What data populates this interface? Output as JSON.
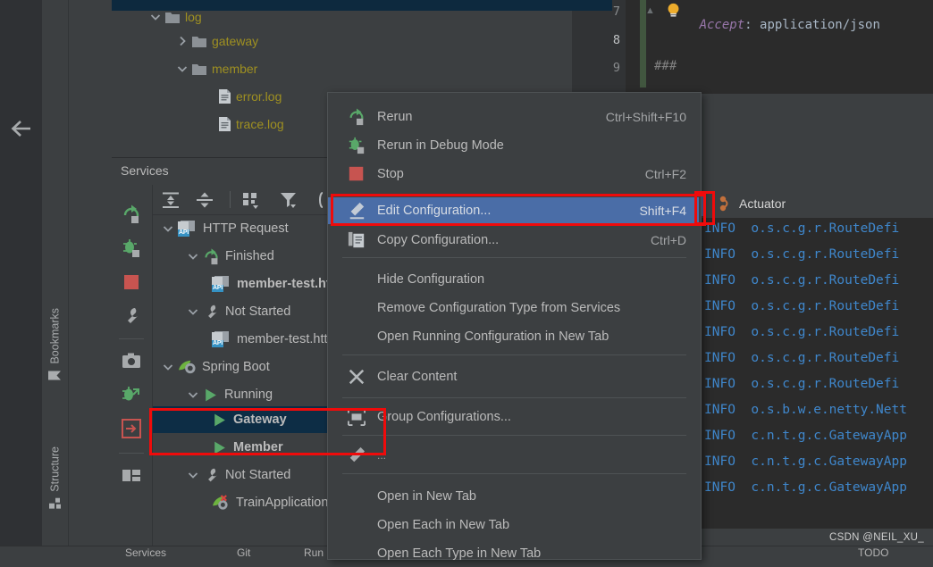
{
  "window": {
    "watermark": "CSDN @NEIL_XU_"
  },
  "left_rail": {
    "back_icon": "back-arrow-icon",
    "labels": [
      {
        "label": "Bookmarks",
        "icon": "bookmark-icon"
      },
      {
        "label": "Structure",
        "icon": "structure-icon"
      }
    ]
  },
  "editor": {
    "lines": [
      {
        "number": "7",
        "text": "Accept: application/json",
        "kind": "header"
      },
      {
        "number": "8",
        "text": "",
        "kind": "blank"
      },
      {
        "number": "9",
        "text": "###",
        "kind": "comment"
      }
    ],
    "header_name": "Accept",
    "header_value": "application/json",
    "comment_text": "###",
    "intention_icon": "lightbulb-icon",
    "fold_icon": "fold-marker-icon"
  },
  "project_tree": {
    "selected_file": "member-test.http",
    "nodes": [
      {
        "label": "log",
        "indent": 42,
        "chevron": "down",
        "icon": "folder-icon"
      },
      {
        "label": "gateway",
        "indent": 72,
        "chevron": "right",
        "icon": "folder-icon"
      },
      {
        "label": "member",
        "indent": 72,
        "chevron": "down",
        "icon": "folder-icon"
      },
      {
        "label": "error.log",
        "indent": 120,
        "chevron": "none",
        "icon": "log-file-icon"
      },
      {
        "label": "trace.log",
        "indent": 120,
        "chevron": "none",
        "icon": "log-file-icon"
      }
    ]
  },
  "services": {
    "title": "Services",
    "rail_buttons": [
      {
        "name": "rerun-icon"
      },
      {
        "name": "rerun-debug-icon"
      },
      {
        "name": "stop-icon"
      },
      {
        "name": "settings-wrench-icon"
      },
      {
        "name": "screenshot-camera-icon"
      },
      {
        "name": "debug-attach-icon"
      },
      {
        "name": "import-icon"
      },
      {
        "name": "layout-icon"
      }
    ],
    "toolbar_buttons": [
      {
        "name": "expand-all-icon"
      },
      {
        "name": "collapse-all-icon"
      },
      {
        "name": "group-by-icon"
      },
      {
        "name": "filter-icon"
      },
      {
        "name": "soft-wrap-icon"
      }
    ],
    "tree": [
      {
        "label": "HTTP Request",
        "indent": 10,
        "chevron": "down",
        "icon": "api-badge-icon",
        "bold": false
      },
      {
        "label": "Finished",
        "indent": 38,
        "chevron": "down",
        "icon": "rerun-icon",
        "bold": false
      },
      {
        "label": "member-test.http",
        "indent": 66,
        "chevron": "none",
        "icon": "api-badge-icon",
        "bold": true
      },
      {
        "label": "Not Started",
        "indent": 38,
        "chevron": "down",
        "icon": "settings-wrench-icon",
        "bold": false
      },
      {
        "label": "member-test.http",
        "indent": 66,
        "chevron": "none",
        "icon": "api-badge-icon",
        "bold": false
      },
      {
        "label": "Spring Boot",
        "indent": 10,
        "chevron": "down",
        "icon": "spring-boot-icon",
        "bold": false
      },
      {
        "label": "Running",
        "indent": 38,
        "chevron": "down",
        "icon": "run-triangle-icon",
        "bold": false
      },
      {
        "label": "Gateway",
        "indent": 66,
        "chevron": "none",
        "icon": "run-triangle-icon",
        "bold": true,
        "selected": true
      },
      {
        "label": "Member",
        "indent": 66,
        "chevron": "none",
        "icon": "run-triangle-icon",
        "bold": true
      },
      {
        "label": "Not Started",
        "indent": 38,
        "chevron": "down",
        "icon": "settings-wrench-icon",
        "bold": false
      },
      {
        "label": "TrainApplication",
        "indent": 66,
        "chevron": "none",
        "icon": "spring-boot-error-icon",
        "bold": false
      }
    ]
  },
  "context_menu": {
    "items": [
      {
        "label": "Rerun",
        "shortcut": "Ctrl+Shift+F10",
        "icon": "rerun-icon",
        "selected": false
      },
      {
        "label": "Rerun in Debug Mode",
        "shortcut": "",
        "icon": "rerun-debug-icon",
        "selected": false
      },
      {
        "label": "Stop",
        "shortcut": "Ctrl+F2",
        "icon": "stop-icon",
        "selected": false
      },
      {
        "label": "Edit Configuration...",
        "shortcut": "Shift+F4",
        "icon": "edit-pencil-icon",
        "selected": true
      },
      {
        "label": "Copy Configuration...",
        "shortcut": "Ctrl+D",
        "icon": "copy-icon",
        "selected": false
      },
      {
        "label": "Hide Configuration",
        "shortcut": "",
        "icon": "",
        "selected": false
      },
      {
        "label": "Remove Configuration Type from Services",
        "shortcut": "",
        "icon": "",
        "selected": false
      },
      {
        "label": "Open Running Configuration in New Tab",
        "shortcut": "",
        "icon": "",
        "selected": false
      },
      {
        "label": "Clear Content",
        "shortcut": "",
        "icon": "clear-x-icon",
        "selected": false
      },
      {
        "label": "Group Configurations...",
        "shortcut": "",
        "icon": "group-configurations-icon",
        "selected": false
      },
      {
        "label": "...",
        "shortcut": "",
        "icon": "edit-pencil-icon",
        "selected": false
      },
      {
        "label": "Open in New Tab",
        "shortcut": "",
        "icon": "",
        "selected": false
      },
      {
        "label": "Open Each in New Tab",
        "shortcut": "",
        "icon": "",
        "selected": false
      },
      {
        "label": "Open Each Type in New Tab",
        "shortcut": "",
        "icon": "",
        "selected": false
      }
    ]
  },
  "console": {
    "tab_label": "Actuator",
    "tab_icon": "actuator-icon",
    "log_lines": [
      {
        "level": "INFO",
        "logger": "o.s.c.g.r.RouteDefi"
      },
      {
        "level": "INFO",
        "logger": "o.s.c.g.r.RouteDefi"
      },
      {
        "level": "INFO",
        "logger": "o.s.c.g.r.RouteDefi"
      },
      {
        "level": "INFO",
        "logger": "o.s.c.g.r.RouteDefi"
      },
      {
        "level": "INFO",
        "logger": "o.s.c.g.r.RouteDefi"
      },
      {
        "level": "INFO",
        "logger": "o.s.c.g.r.RouteDefi"
      },
      {
        "level": "INFO",
        "logger": "o.s.c.g.r.RouteDefi"
      },
      {
        "level": "INFO",
        "logger": "o.s.b.w.e.netty.Nett"
      },
      {
        "level": "INFO",
        "logger": "c.n.t.g.c.GatewayApp"
      },
      {
        "level": "INFO",
        "logger": "c.n.t.g.c.GatewayApp"
      },
      {
        "level": "INFO",
        "logger": "c.n.t.g.c.GatewayApp"
      }
    ]
  },
  "status_bar": {
    "items": [
      {
        "label": "Services",
        "icon": "services-icon"
      },
      {
        "label": "Git",
        "icon": "git-icon"
      },
      {
        "label": "Run",
        "icon": "run-icon"
      },
      {
        "label": "TODO",
        "icon": "todo-icon"
      }
    ]
  },
  "colors": {
    "accent_blue": "#4a6da7",
    "selection_navy": "#0d2d45",
    "annotation_red": "#ef0b0b",
    "log_blue": "#3f87cc",
    "folder_yellow": "#9f9021",
    "green_run": "#59a869",
    "stop_red": "#c75450"
  },
  "annotations": [
    {
      "name": "edit-configuration-highlight"
    },
    {
      "name": "gateway-row-highlight"
    },
    {
      "name": "actuator-tab-highlight"
    }
  ]
}
